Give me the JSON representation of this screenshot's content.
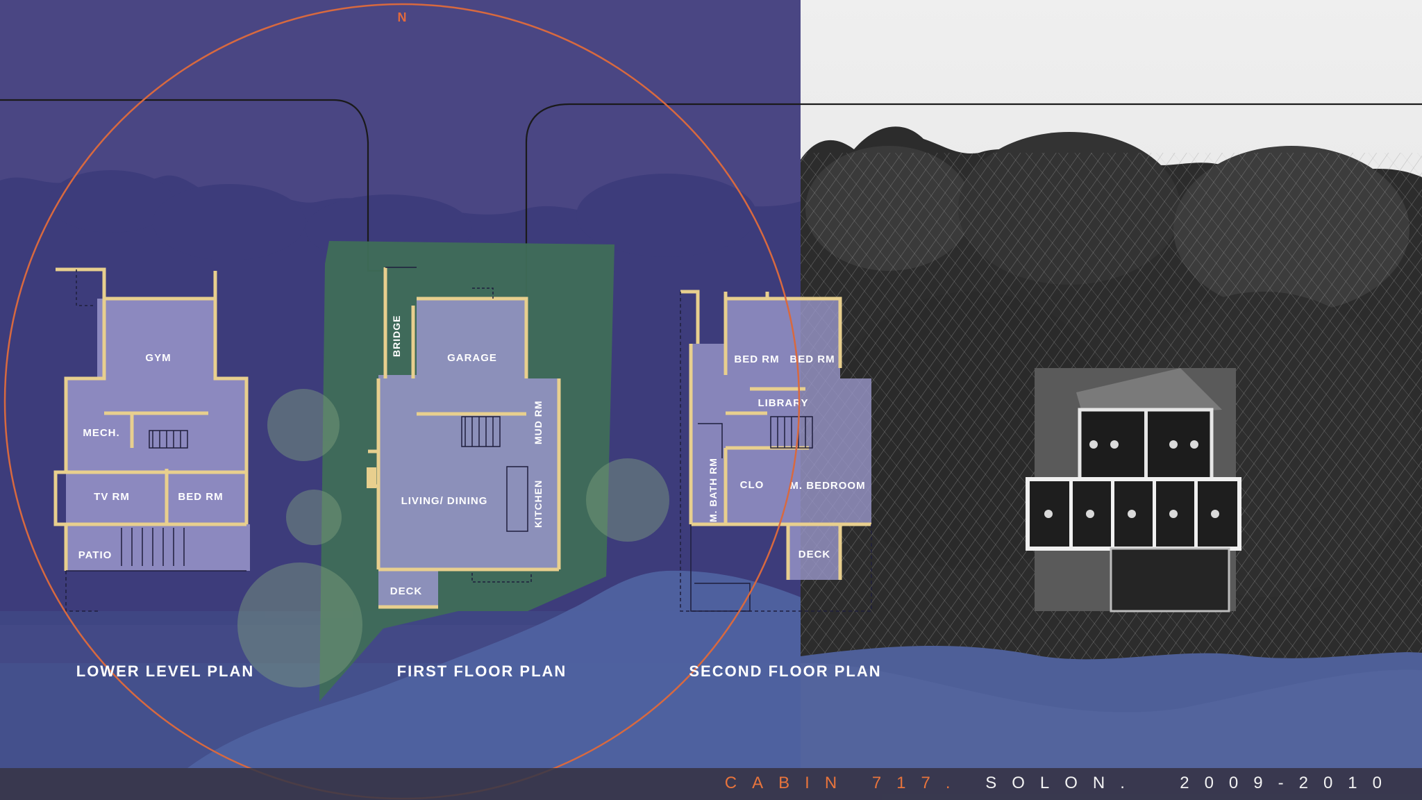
{
  "compass": {
    "label": "N"
  },
  "plans": {
    "lower": {
      "title": "LOWER LEVEL PLAN",
      "rooms": {
        "gym": "GYM",
        "mech": "MECH.",
        "tv": "TV RM",
        "bed": "BED RM",
        "patio": "PATIO"
      }
    },
    "first": {
      "title": "FIRST FLOOR PLAN",
      "rooms": {
        "bridge": "BRIDGE",
        "garage": "GARAGE",
        "mud": "MUD RM",
        "living": "LIVING/ DINING",
        "kitchen": "KITCHEN",
        "deck": "DECK"
      }
    },
    "second": {
      "title": "SECOND FLOOR PLAN",
      "rooms": {
        "bed1": "BED RM",
        "bed2": "BED RM",
        "library": "LIBRARY",
        "bath": "M. BATH RM",
        "clo": "CLO",
        "master": "M. BEDROOM",
        "deck": "DECK"
      }
    }
  },
  "footer": {
    "project": "CABIN 717.",
    "rest": " SOLON.  2009-2010"
  },
  "colors": {
    "plan_bg": "#4a4683",
    "site_green": "#3f6d58",
    "wall_fill": "#e8cf8e",
    "room_fill": "#9a97cb",
    "orientation_circle": "#d8693f",
    "accent": "#e8743c"
  }
}
